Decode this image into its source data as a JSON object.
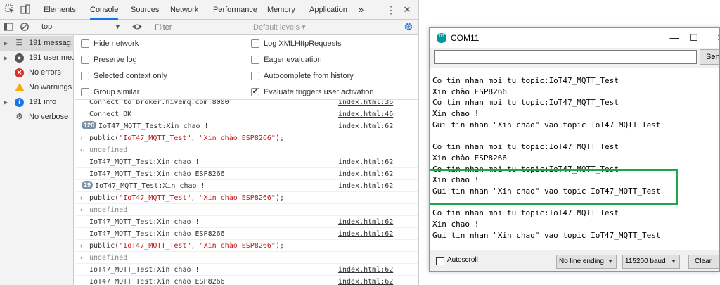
{
  "devtools": {
    "tabs": [
      "Elements",
      "Console",
      "Sources",
      "Network",
      "Performance",
      "Memory",
      "Application"
    ],
    "active_tab": "Console",
    "more_tabs_glyph": "»",
    "context": "top",
    "filter_placeholder": "Filter",
    "levels_label": "Default levels ▾",
    "icons": {
      "inspect": "inspect-icon",
      "device": "device-toggle-icon",
      "menu": "kebab-menu-icon",
      "close": "close-icon",
      "settings": "gear-icon"
    },
    "accent_color": "#1a73e8",
    "sidebar": [
      {
        "label": "191 messag...",
        "icon": "list-icon",
        "selected": true
      },
      {
        "label": "191 user me...",
        "icon": "user-icon"
      },
      {
        "label": "No errors",
        "icon": "error-icon"
      },
      {
        "label": "No warnings",
        "icon": "warning-icon"
      },
      {
        "label": "191 info",
        "icon": "info-icon"
      },
      {
        "label": "No verbose",
        "icon": "verbose-icon"
      }
    ],
    "settings_left": [
      {
        "label": "Hide network",
        "checked": false
      },
      {
        "label": "Preserve log",
        "checked": false
      },
      {
        "label": "Selected context only",
        "checked": false
      },
      {
        "label": "Group similar",
        "checked": false
      }
    ],
    "settings_right": [
      {
        "label": "Log XMLHttpRequests",
        "checked": false
      },
      {
        "label": "Eager evaluation",
        "checked": false
      },
      {
        "label": "Autocomplete from history",
        "checked": false
      },
      {
        "label": "Evaluate triggers user activation",
        "checked": true
      }
    ],
    "log": [
      {
        "kind": "log",
        "text": "Connect to broker.hivemq.com:8000",
        "src": "index.html:36"
      },
      {
        "kind": "log",
        "text": "Connect OK",
        "src": "index.html:46"
      },
      {
        "kind": "log",
        "badge": "126",
        "text": "IoT47_MQTT_Test:Xin chao !",
        "src": "index.html:62"
      },
      {
        "kind": "input",
        "fn": "public(",
        "arg1": "\"IoT47_MQTT_Test\"",
        "sep": ", ",
        "arg2": "\"Xin chào ESP8266\"",
        "end": ");"
      },
      {
        "kind": "result",
        "text": "undefined"
      },
      {
        "kind": "log",
        "text": "IoT47_MQTT_Test:Xin chao !",
        "src": "index.html:62"
      },
      {
        "kind": "log",
        "text": "IoT47_MQTT_Test:Xin chào ESP8266",
        "src": "index.html:62"
      },
      {
        "kind": "log",
        "badge": "29",
        "text": "IoT47_MQTT_Test:Xin chao !",
        "src": "index.html:62"
      },
      {
        "kind": "input",
        "fn": "public(",
        "arg1": "\"IoT47_MQTT_Test\"",
        "sep": ", ",
        "arg2": "\"Xin chào ESP8266\"",
        "end": ");"
      },
      {
        "kind": "result",
        "text": "undefined"
      },
      {
        "kind": "log",
        "text": "IoT47_MQTT_Test:Xin chao !",
        "src": "index.html:62"
      },
      {
        "kind": "log",
        "text": "IoT47_MQTT_Test:Xin chào ESP8266",
        "src": "index.html:62"
      },
      {
        "kind": "input",
        "fn": "public(",
        "arg1": "\"IoT47_MQTT_Test\"",
        "sep": ", ",
        "arg2": "\"Xin chào ESP8266\"",
        "end": ");"
      },
      {
        "kind": "result",
        "text": "undefined"
      },
      {
        "kind": "log",
        "text": "IoT47_MQTT_Test:Xin chao !",
        "src": "index.html:62"
      },
      {
        "kind": "log",
        "text": "IoT47_MQTT_Test:Xin chào ESP8266",
        "src": "index.html:62"
      }
    ]
  },
  "serial": {
    "title": "COM11",
    "send_label": "Send",
    "lines": [
      "Co tin nhan moi tu topic:IoT47_MQTT_Test",
      "Xin chào ESP8266",
      "Co tin nhan moi tu topic:IoT47_MQTT_Test",
      "Xin chao !",
      "Gui tin nhan \"Xin chao\" vao topic IoT47_MQTT_Test",
      "",
      "Co tin nhan moi tu topic:IoT47_MQTT_Test",
      "Xin chào ESP8266",
      "Co tin nhan moi tu topic:IoT47_MQTT_Test",
      "Xin chao !",
      "Gui tin nhan \"Xin chao\" vao topic IoT47_MQTT_Test",
      "",
      "Co tin nhan moi tu topic:IoT47_MQTT_Test",
      "Xin chao !",
      "Gui tin nhan \"Xin chao\" vao topic IoT47_MQTT_Test"
    ],
    "highlight_color": "#1ea64a",
    "autoscroll_label": "Autoscroll",
    "autoscroll_checked": false,
    "line_ending": "No line ending",
    "baud": "115200 baud",
    "clear_label": "Clear output"
  }
}
